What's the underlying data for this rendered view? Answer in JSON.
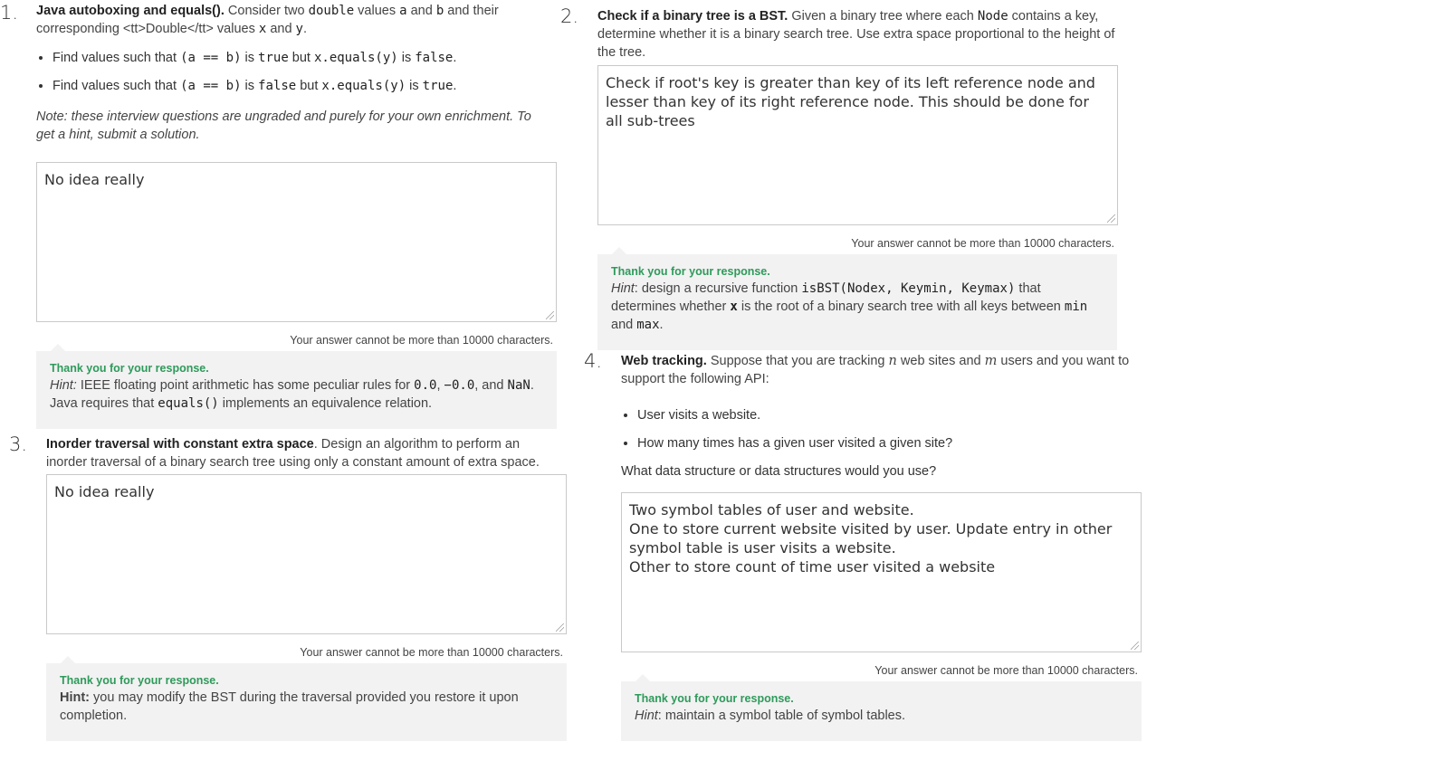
{
  "common": {
    "char_limit": "Your answer cannot be more than 10000 characters.",
    "thanks": "Thank you for your response."
  },
  "q1": {
    "number": "1.",
    "title": "Java autoboxing and equals().",
    "text_a": " Consider two ",
    "code_double": "double",
    "text_b": " values ",
    "code_a": "a",
    "text_c": " and ",
    "code_b": "b",
    "text_d": " and their corresponding <tt>Double</tt> values ",
    "code_x": "x",
    "text_e": " and ",
    "code_y": "y",
    "text_f": ".",
    "bullets": [
      {
        "pre": "Find values such that ",
        "expr": "(a == b)",
        "mid": " is ",
        "v1": "true",
        "but": " but ",
        "call": "x.equals(y)",
        "is": " is ",
        "v2": "false",
        "end": "."
      },
      {
        "pre": "Find values such that ",
        "expr": "(a == b)",
        "mid": " is ",
        "v1": "false",
        "but": " but ",
        "call": "x.equals(y)",
        "is": " is ",
        "v2": "true",
        "end": "."
      }
    ],
    "note": "Note: these interview questions are ungraded and purely for your own enrichment. To get a hint, submit a solution.",
    "answer": "No idea really",
    "hint_label": "Hint:",
    "hint_a": " IEEE floating point arithmetic has some peculiar rules for ",
    "hint_c1": "0.0",
    "hint_sep1": ", ",
    "hint_c2": "−0.0",
    "hint_sep2": ", and ",
    "hint_c3": "NaN",
    "hint_b": ". Java requires that ",
    "hint_c4": "equals()",
    "hint_c": " implements an equivalence relation."
  },
  "q2": {
    "number": "2.",
    "title": "Check if a binary tree is a BST.",
    "text_a": " Given a binary tree where each ",
    "code_node": "Node",
    "text_b": " contains a key, determine whether it is a binary search tree. Use extra space proportional to the height of the tree.",
    "answer": "Check if root's key is greater than key of its left reference node and lesser than key of its right reference node. This should be done for all sub-trees",
    "hint_label": "Hint",
    "hint_a": ": design a recursive function ",
    "hint_code": "isBST(Nodex, Keymin, Keymax)",
    "hint_b": " that determines whether ",
    "hint_x": "x",
    "hint_c": " is the root of a binary search tree with all keys between ",
    "hint_min": "min",
    "hint_and": " and ",
    "hint_max": "max",
    "hint_end": "."
  },
  "q3": {
    "number": "3.",
    "title": "Inorder traversal with constant extra space",
    "text_a": ". Design an algorithm to perform an inorder traversal of a binary search tree using only a constant amount of extra space.",
    "answer": "No idea really",
    "hint_label": "Hint:",
    "hint_text": " you may modify the BST during the traversal provided you restore it upon completion."
  },
  "q4": {
    "number": "4.",
    "title": "Web tracking.",
    "text_a": " Suppose that you are tracking ",
    "var_n": "n",
    "text_b": " web sites and ",
    "var_m": "m",
    "text_c": " users and you want to support the following API:",
    "bullets": [
      "User visits a website.",
      "How many times has a given user visited a given site?"
    ],
    "question": "What data structure or data structures would you use?",
    "answer": "Two symbol tables of user and website.\nOne to store current website visited by user. Update entry in other symbol table is user visits a website.\nOther to store count of time user visited a website",
    "hint_label": "Hint",
    "hint_text": ": maintain a symbol table of symbol tables."
  }
}
